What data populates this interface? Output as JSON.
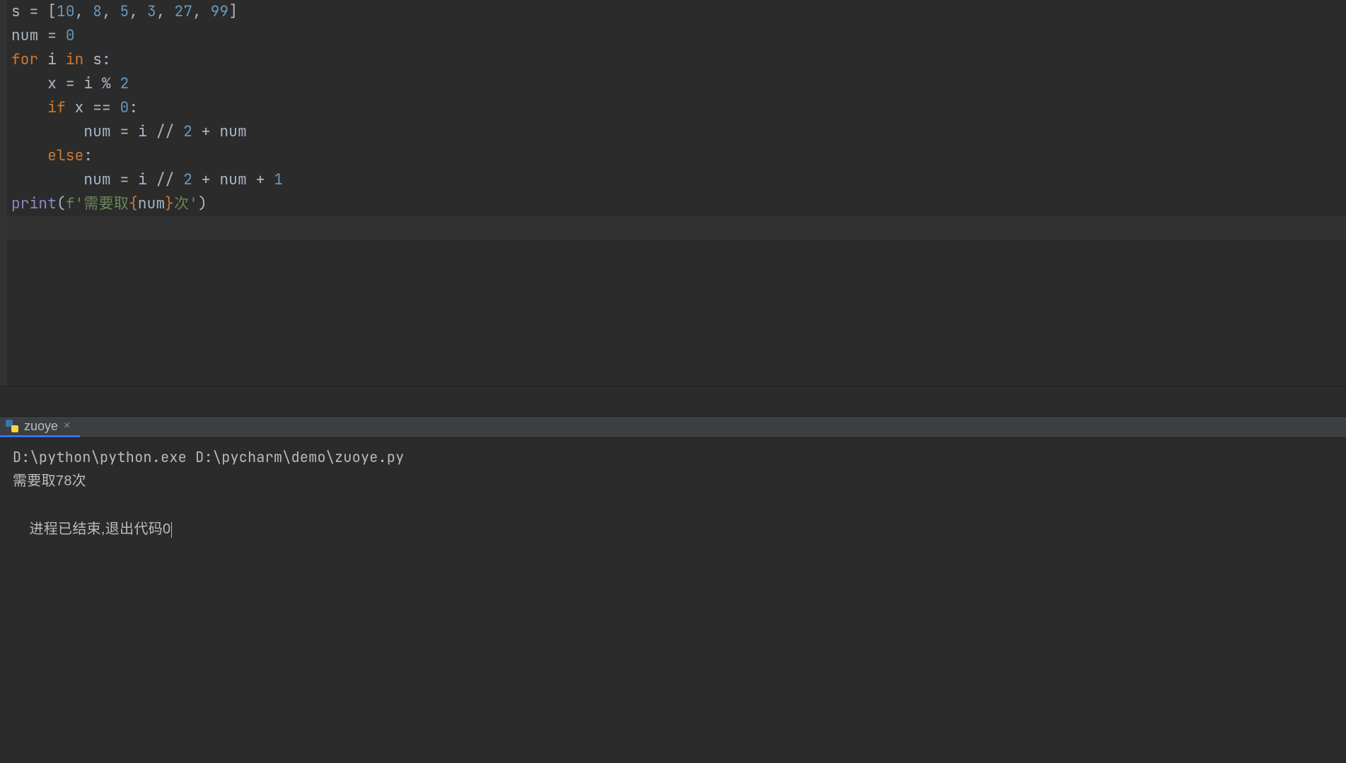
{
  "editor": {
    "tokens": [
      [
        {
          "t": "s ",
          "c": "tok-default"
        },
        {
          "t": "=",
          "c": "tok-op"
        },
        {
          "t": " [",
          "c": "tok-default"
        },
        {
          "t": "10",
          "c": "tok-number"
        },
        {
          "t": ", ",
          "c": "tok-default"
        },
        {
          "t": "8",
          "c": "tok-number"
        },
        {
          "t": ", ",
          "c": "tok-default"
        },
        {
          "t": "5",
          "c": "tok-number"
        },
        {
          "t": ", ",
          "c": "tok-default"
        },
        {
          "t": "3",
          "c": "tok-number"
        },
        {
          "t": ", ",
          "c": "tok-default"
        },
        {
          "t": "27",
          "c": "tok-number"
        },
        {
          "t": ", ",
          "c": "tok-default"
        },
        {
          "t": "99",
          "c": "tok-number"
        },
        {
          "t": "]",
          "c": "tok-default"
        }
      ],
      [
        {
          "t": "num ",
          "c": "tok-default"
        },
        {
          "t": "=",
          "c": "tok-op"
        },
        {
          "t": " ",
          "c": "tok-default"
        },
        {
          "t": "0",
          "c": "tok-number"
        }
      ],
      [
        {
          "t": "for ",
          "c": "tok-keyword"
        },
        {
          "t": "i ",
          "c": "tok-default"
        },
        {
          "t": "in ",
          "c": "tok-keyword"
        },
        {
          "t": "s:",
          "c": "tok-default"
        }
      ],
      [
        {
          "t": "    x ",
          "c": "tok-default"
        },
        {
          "t": "=",
          "c": "tok-op"
        },
        {
          "t": " i ",
          "c": "tok-default"
        },
        {
          "t": "%",
          "c": "tok-op"
        },
        {
          "t": " ",
          "c": "tok-default"
        },
        {
          "t": "2",
          "c": "tok-number"
        }
      ],
      [
        {
          "t": "    ",
          "c": "tok-default"
        },
        {
          "t": "if ",
          "c": "tok-keyword"
        },
        {
          "t": "x ",
          "c": "tok-default"
        },
        {
          "t": "==",
          "c": "tok-op"
        },
        {
          "t": " ",
          "c": "tok-default"
        },
        {
          "t": "0",
          "c": "tok-number"
        },
        {
          "t": ":",
          "c": "tok-default"
        }
      ],
      [
        {
          "t": "        num ",
          "c": "tok-default"
        },
        {
          "t": "=",
          "c": "tok-op"
        },
        {
          "t": " i ",
          "c": "tok-default"
        },
        {
          "t": "//",
          "c": "tok-op"
        },
        {
          "t": " ",
          "c": "tok-default"
        },
        {
          "t": "2",
          "c": "tok-number"
        },
        {
          "t": " ",
          "c": "tok-default"
        },
        {
          "t": "+",
          "c": "tok-op"
        },
        {
          "t": " num",
          "c": "tok-default"
        }
      ],
      [
        {
          "t": "    ",
          "c": "tok-default"
        },
        {
          "t": "else",
          "c": "tok-keyword"
        },
        {
          "t": ":",
          "c": "tok-default"
        }
      ],
      [
        {
          "t": "        num ",
          "c": "tok-default"
        },
        {
          "t": "=",
          "c": "tok-op"
        },
        {
          "t": " i ",
          "c": "tok-default"
        },
        {
          "t": "//",
          "c": "tok-op"
        },
        {
          "t": " ",
          "c": "tok-default"
        },
        {
          "t": "2",
          "c": "tok-number"
        },
        {
          "t": " ",
          "c": "tok-default"
        },
        {
          "t": "+",
          "c": "tok-op"
        },
        {
          "t": " num ",
          "c": "tok-default"
        },
        {
          "t": "+",
          "c": "tok-op"
        },
        {
          "t": " ",
          "c": "tok-default"
        },
        {
          "t": "1",
          "c": "tok-number"
        }
      ],
      [
        {
          "t": "print",
          "c": "tok-builtin"
        },
        {
          "t": "(",
          "c": "tok-default"
        },
        {
          "t": "f'",
          "c": "tok-string"
        },
        {
          "t": "需要取",
          "c": "tok-string"
        },
        {
          "t": "{",
          "c": "tok-brace"
        },
        {
          "t": "num",
          "c": "tok-default"
        },
        {
          "t": "}",
          "c": "tok-brace"
        },
        {
          "t": "次",
          "c": "tok-string"
        },
        {
          "t": "'",
          "c": "tok-string"
        },
        {
          "t": ")",
          "c": "tok-default"
        }
      ]
    ]
  },
  "run_tab": {
    "label": "zuoye",
    "close": "×"
  },
  "console": {
    "lines": [
      "D:\\python\\python.exe D:\\pycharm\\demo\\zuoye.py",
      "需要取78次",
      "",
      "进程已结束,退出代码0"
    ]
  }
}
